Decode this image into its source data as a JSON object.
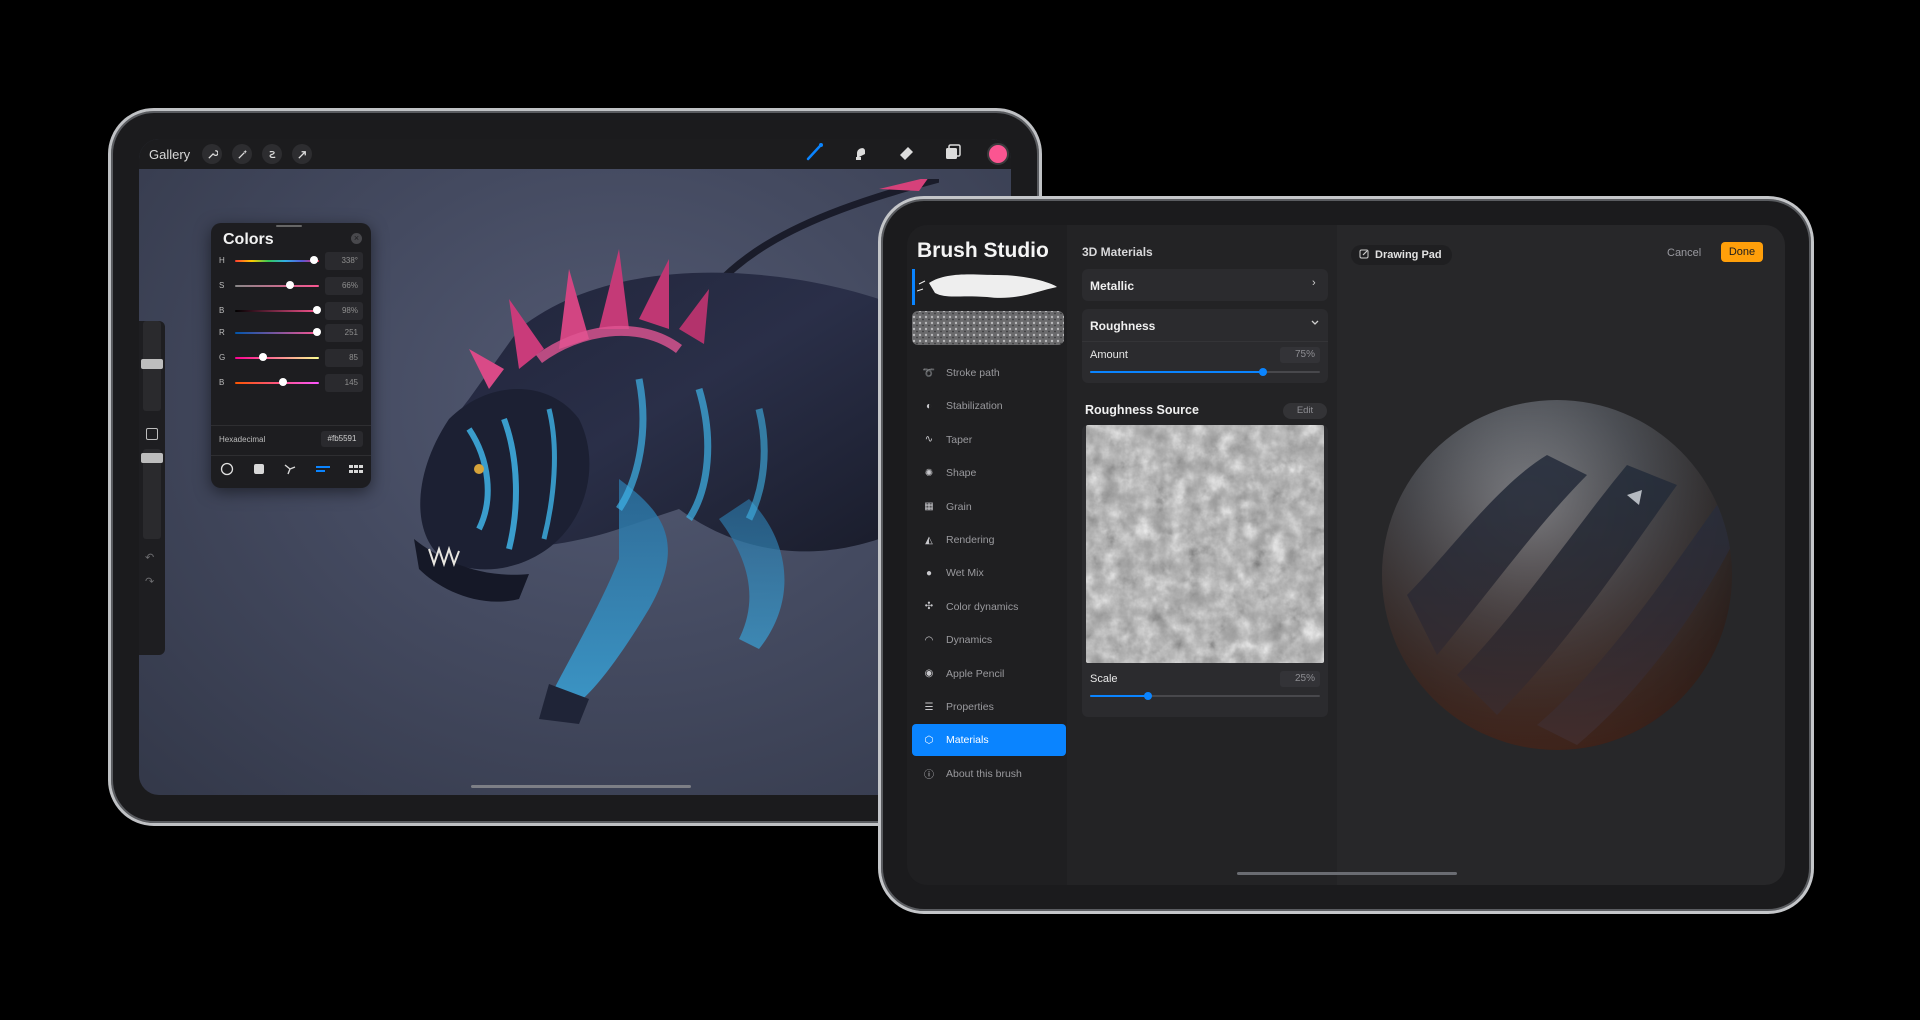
{
  "procreate": {
    "topbar": {
      "gallery_label": "Gallery",
      "left_icons": [
        "wrench-icon",
        "magic-wand-icon",
        "selection-icon",
        "transform-arrow-icon"
      ],
      "right_icons": [
        "brush-icon",
        "smudge-icon",
        "eraser-icon",
        "layers-icon"
      ],
      "active_color": "#fb5591"
    },
    "colors_panel": {
      "title": "Colors",
      "hsb": [
        {
          "label": "H",
          "value_text": "338°",
          "fraction": 0.94
        },
        {
          "label": "S",
          "value_text": "66%",
          "fraction": 0.66
        },
        {
          "label": "B",
          "value_text": "98%",
          "fraction": 0.98
        }
      ],
      "rgb": [
        {
          "label": "R",
          "value_text": "251",
          "fraction": 0.98
        },
        {
          "label": "G",
          "value_text": "85",
          "fraction": 0.33
        },
        {
          "label": "B",
          "value_text": "145",
          "fraction": 0.57
        }
      ],
      "hex_label": "Hexadecimal",
      "hex_value": "#fb5591",
      "mode_icons": [
        "disc-icon",
        "classic-square-icon",
        "harmony-icon",
        "value-icon",
        "palettes-icon"
      ]
    }
  },
  "brush_studio": {
    "title": "Brush Studio",
    "menu": [
      {
        "label": "Stroke path",
        "icon": "stroke-path-icon"
      },
      {
        "label": "Stabilization",
        "icon": "stabilization-icon"
      },
      {
        "label": "Taper",
        "icon": "taper-icon"
      },
      {
        "label": "Shape",
        "icon": "shape-icon"
      },
      {
        "label": "Grain",
        "icon": "grain-icon"
      },
      {
        "label": "Rendering",
        "icon": "rendering-icon"
      },
      {
        "label": "Wet Mix",
        "icon": "wet-mix-icon"
      },
      {
        "label": "Color dynamics",
        "icon": "color-dynamics-icon"
      },
      {
        "label": "Dynamics",
        "icon": "dynamics-icon"
      },
      {
        "label": "Apple Pencil",
        "icon": "apple-pencil-icon"
      },
      {
        "label": "Properties",
        "icon": "properties-icon"
      },
      {
        "label": "Materials",
        "icon": "materials-icon",
        "active": true
      },
      {
        "label": "About this brush",
        "icon": "info-icon"
      }
    ],
    "section_title": "3D Materials",
    "metallic_label": "Metallic",
    "roughness": {
      "label": "Roughness",
      "amount_label": "Amount",
      "amount_text": "75%",
      "amount_fraction": 0.75
    },
    "roughness_source": {
      "label": "Roughness Source",
      "edit_label": "Edit",
      "scale_label": "Scale",
      "scale_text": "25%",
      "scale_fraction": 0.25
    },
    "drawing_pad_label": "Drawing Pad",
    "cancel_label": "Cancel",
    "done_label": "Done",
    "accent_color": "#0a84ff",
    "done_color": "#ff9f0a"
  }
}
